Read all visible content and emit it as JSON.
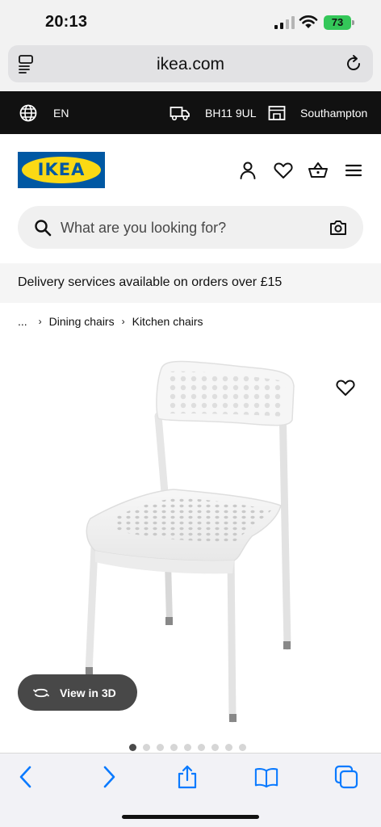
{
  "status_bar": {
    "time": "20:13",
    "battery": "73"
  },
  "browser": {
    "domain": "ikea.com"
  },
  "utility_bar": {
    "language": "EN",
    "postcode": "BH11 9UL",
    "store": "Southampton"
  },
  "header": {
    "logo_text": "IKEA"
  },
  "search": {
    "placeholder": "What are you looking for?"
  },
  "banner": {
    "text": "Delivery services available on orders over £15"
  },
  "breadcrumb": {
    "ellipsis": "...",
    "items": [
      "Dining chairs",
      "Kitchen chairs"
    ]
  },
  "product": {
    "view_3d_label": "View in 3D",
    "image_count": 9,
    "active_image": 0
  },
  "colors": {
    "brand_blue": "#0058a3",
    "brand_yellow": "#fbd914",
    "ios_blue": "#0a7aff",
    "battery_green": "#34c759"
  },
  "icons": [
    "globe-icon",
    "delivery-truck-icon",
    "store-icon",
    "user-icon",
    "heart-icon",
    "basket-icon",
    "menu-icon",
    "search-icon",
    "camera-icon",
    "rotate-3d-icon",
    "back-icon",
    "forward-icon",
    "share-icon",
    "bookmarks-icon",
    "tabs-icon"
  ]
}
